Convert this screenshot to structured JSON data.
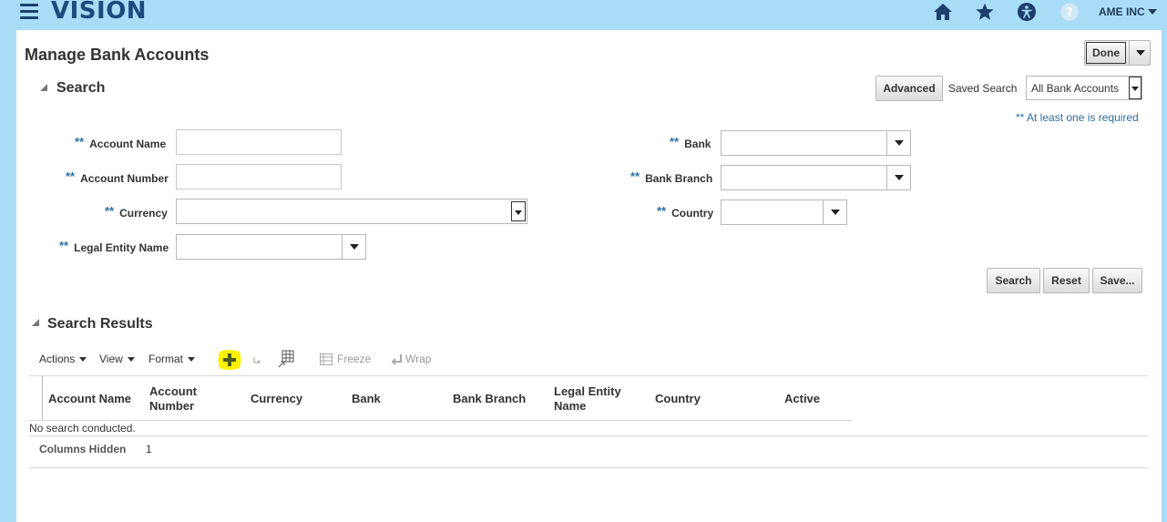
{
  "header": {
    "logo": "VISION",
    "user_menu": "AME INC"
  },
  "page": {
    "title": "Manage Bank Accounts",
    "done_label": "Done"
  },
  "search": {
    "section_title": "Search",
    "advanced_label": "Advanced",
    "saved_search_label": "Saved Search",
    "saved_search_value": "All Bank Accounts",
    "required_note": "** At least one is required",
    "required_marker": "**",
    "fields": {
      "account_name": "Account Name",
      "account_number": "Account Number",
      "currency": "Currency",
      "legal_entity_name": "Legal Entity Name",
      "bank": "Bank",
      "bank_branch": "Bank Branch",
      "country": "Country"
    },
    "search_button": "Search",
    "reset_button": "Reset",
    "save_button": "Save..."
  },
  "results": {
    "section_title": "Search Results",
    "toolbar": {
      "actions": "Actions",
      "view": "View",
      "format": "Format",
      "freeze": "Freeze",
      "wrap": "Wrap"
    },
    "columns": [
      "Account Name",
      "Account Number",
      "Currency",
      "Bank",
      "Bank Branch",
      "Legal Entity Name",
      "Country",
      "Active"
    ],
    "empty_message": "No search conducted.",
    "columns_hidden_label": "Columns Hidden",
    "columns_hidden_value": "1"
  },
  "colors": {
    "background": "#a9dcf7",
    "logo": "#1c4a7d",
    "required": "#2b6ea3",
    "highlight": "#fff200"
  }
}
